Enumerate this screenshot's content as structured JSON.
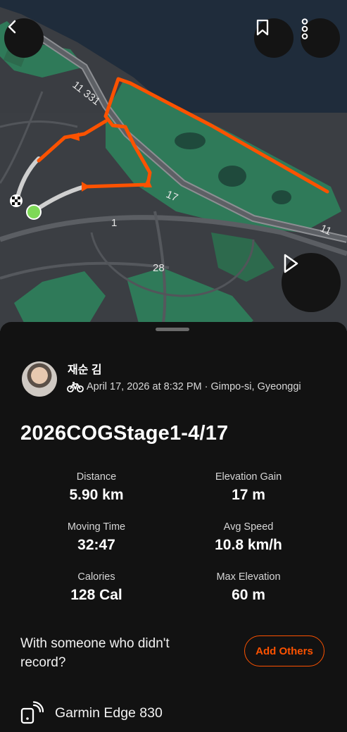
{
  "map": {
    "road_labels": [
      "11 331",
      "17",
      "1",
      "28",
      "11"
    ]
  },
  "activity": {
    "athlete_name": "재순 김",
    "date_location": "April 17, 2026 at 8:32 PM · Gimpo-si, Gyeonggi",
    "activity_type_icon": "bike-icon",
    "title": "2026COGStage1-4/17"
  },
  "stats": [
    {
      "label": "Distance",
      "value": "5.90 km"
    },
    {
      "label": "Elevation Gain",
      "value": "17 m"
    },
    {
      "label": "Moving Time",
      "value": "32:47"
    },
    {
      "label": "Avg Speed",
      "value": "10.8 km/h"
    },
    {
      "label": "Calories",
      "value": "128 Cal"
    },
    {
      "label": "Max Elevation",
      "value": "60 m"
    }
  ],
  "with_others": {
    "prompt": "With someone who didn't record?",
    "button_label": "Add Others"
  },
  "device": {
    "name": "Garmin Edge 830"
  },
  "colors": {
    "accent": "#fc5200",
    "route": "#fc5200",
    "park": "#2f7a59",
    "water": "#1f2c3b",
    "start_marker": "#7ed957"
  }
}
